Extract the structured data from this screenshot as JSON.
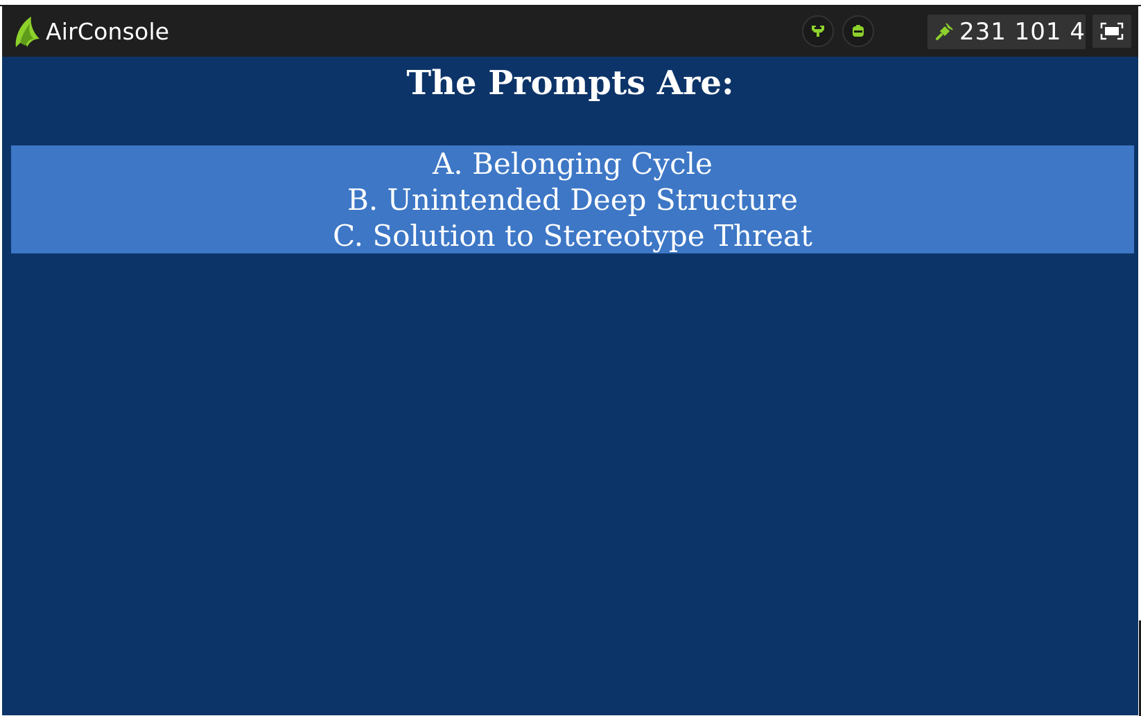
{
  "app": {
    "brand_name": "AirConsole",
    "brand_color": "#8dd12b",
    "background_color": "#0d3468"
  },
  "topbar": {
    "buttons": [
      {
        "icon": "controller-icon"
      },
      {
        "icon": "player-icon"
      }
    ],
    "join_code": {
      "icon": "connect-plug-icon",
      "value": "231 101 4"
    },
    "fullscreen": {
      "icon": "fullscreen-icon"
    }
  },
  "main": {
    "heading": "The Prompts Are:",
    "panel_color": "#3d77c6",
    "prompts": [
      "A. Belonging Cycle",
      "B. Unintended Deep Structure",
      "C. Solution to Stereotype Threat"
    ]
  }
}
